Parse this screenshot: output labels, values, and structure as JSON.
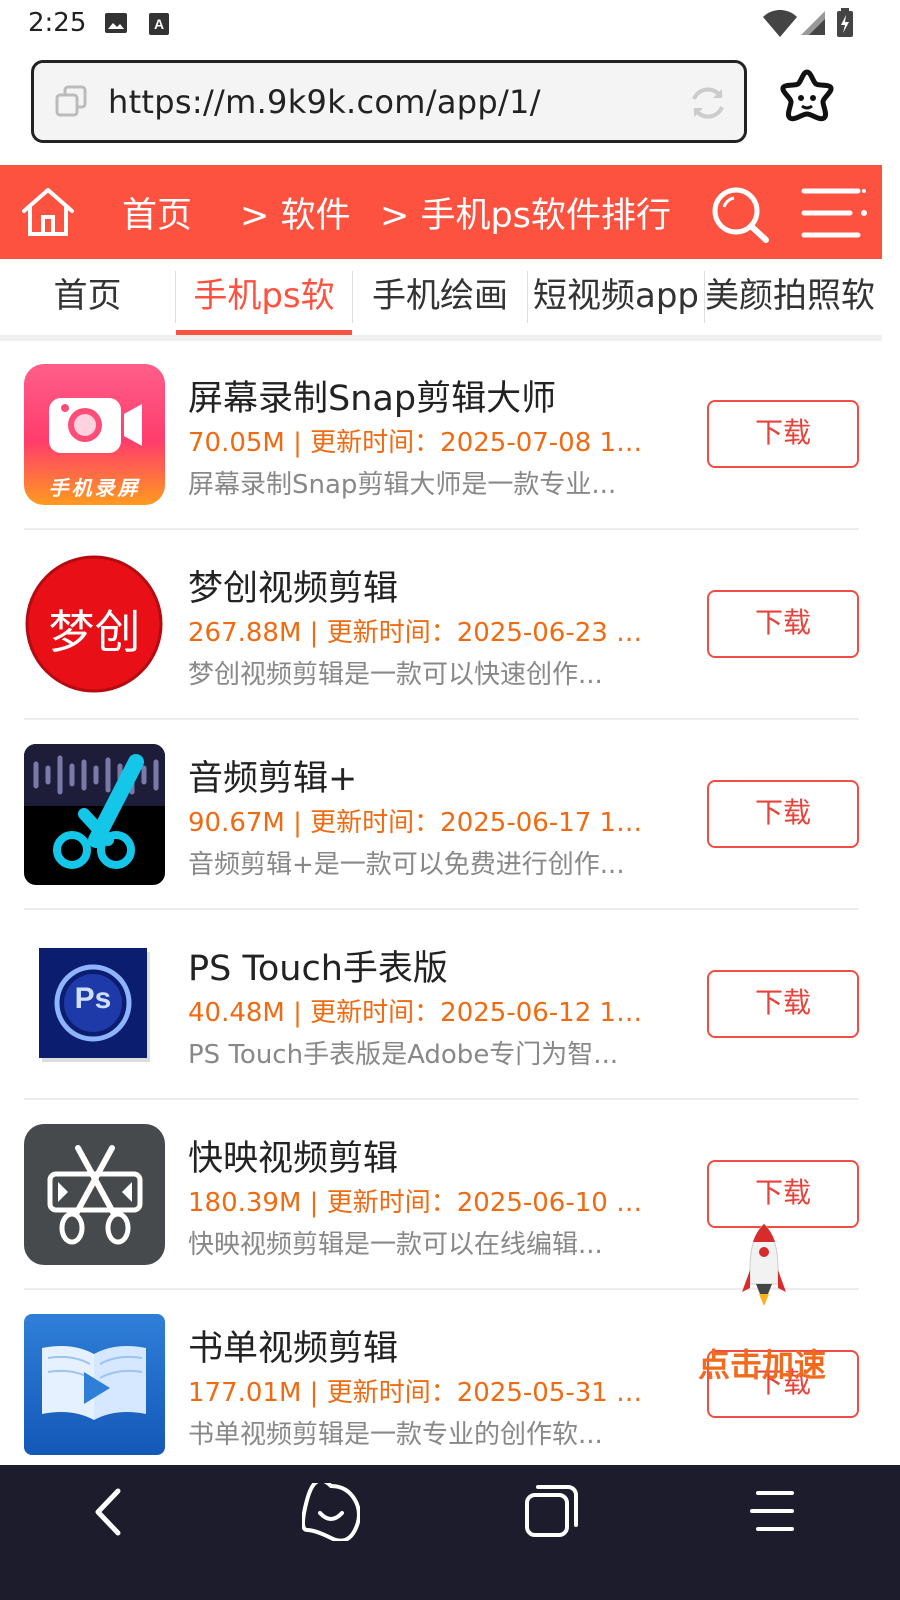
{
  "status": {
    "time": "2:25"
  },
  "browser": {
    "url": "https://m.9k9k.com/app/1/"
  },
  "nav": {
    "home": "首页",
    "crumb_software": "> 软件",
    "crumb_ranking": "> 手机ps软件排行"
  },
  "tabs": [
    {
      "label": "首页"
    },
    {
      "label": "手机ps软",
      "active": true
    },
    {
      "label": "手机绘画"
    },
    {
      "label": "短视频app"
    },
    {
      "label": "美颜拍照软"
    }
  ],
  "apps": [
    {
      "name": "屏幕录制Snap剪辑大师",
      "meta": "70.05M | 更新时间：2025-07-08 16...",
      "desc": "屏幕录制Snap剪辑大师是一款专业...",
      "button": "下载",
      "icon_text": "手机录屏"
    },
    {
      "name": "梦创视频剪辑",
      "meta": "267.88M | 更新时间：2025-06-23 1...",
      "desc": "梦创视频剪辑是一款可以快速创作...",
      "button": "下载",
      "icon_text": "梦创"
    },
    {
      "name": "音频剪辑+",
      "meta": "90.67M | 更新时间：2025-06-17 14...",
      "desc": "音频剪辑+是一款可以免费进行创作...",
      "button": "下载"
    },
    {
      "name": "PS Touch手表版",
      "meta": "40.48M | 更新时间：2025-06-12 11...",
      "desc": "PS Touch手表版是Adobe专门为智...",
      "button": "下载",
      "icon_text": "Ps"
    },
    {
      "name": "快映视频剪辑",
      "meta": "180.39M | 更新时间：2025-06-10 1...",
      "desc": "快映视频剪辑是一款可以在线编辑...",
      "button": "下载"
    },
    {
      "name": "书单视频剪辑",
      "meta": "177.01M | 更新时间：2025-05-31 1...",
      "desc": "书单视频剪辑是一款专业的创作软...",
      "button": "下载"
    }
  ],
  "float": {
    "boost": "点击加速"
  },
  "colors": {
    "brand_red": "#fd5240",
    "meta_orange": "#f06a12",
    "bottom_bar": "#1c1c2c"
  }
}
